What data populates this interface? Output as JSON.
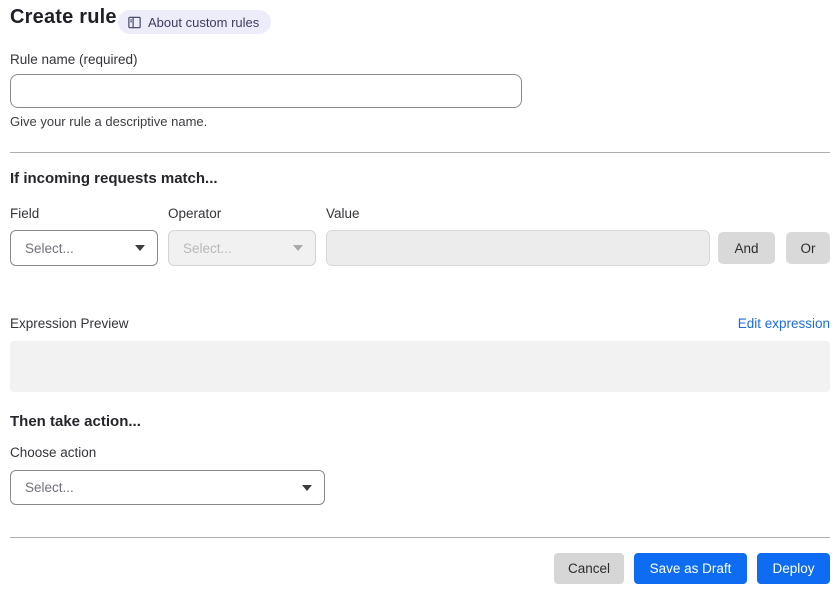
{
  "page": {
    "title": "Create rule",
    "about_badge_label": "About custom rules"
  },
  "rule_name": {
    "label": "Rule name (required)",
    "value": "",
    "helper": "Give your rule a descriptive name."
  },
  "match_section": {
    "heading": "If incoming requests match...",
    "field": {
      "label": "Field",
      "selected": "Select..."
    },
    "operator": {
      "label": "Operator",
      "selected": "Select..."
    },
    "value": {
      "label": "Value",
      "value": ""
    },
    "and_button": "And",
    "or_button": "Or",
    "expression_preview_label": "Expression Preview",
    "edit_expression_link": "Edit expression",
    "expression_value": ""
  },
  "action_section": {
    "heading": "Then take action...",
    "choose_action_label": "Choose action",
    "choose_action_selected": "Select..."
  },
  "footer": {
    "cancel": "Cancel",
    "save_draft": "Save as Draft",
    "deploy": "Deploy"
  },
  "colors": {
    "primary_blue": "#0d6cf2",
    "link_blue": "#1b6ce0",
    "badge_bg": "#edecfb",
    "badge_text": "#3c3c60",
    "disabled_bg": "#f1f1f1",
    "expression_box_bg": "#f2f2f2"
  },
  "icons": {
    "about_badge_icon": "book-icon",
    "dropdown_icon": "chevron-down-icon"
  }
}
